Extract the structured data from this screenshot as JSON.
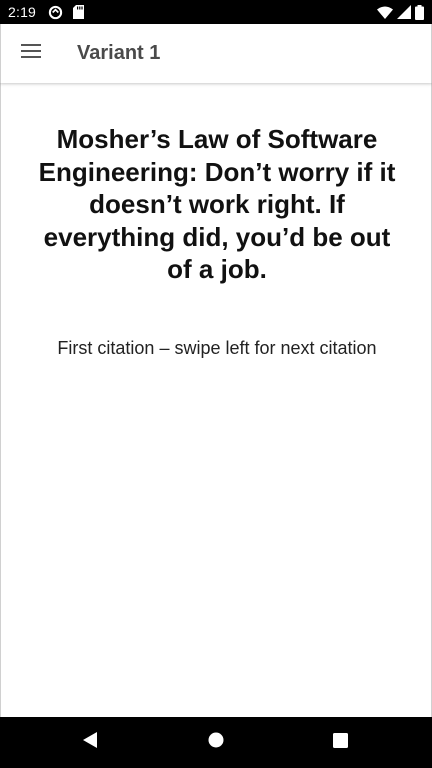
{
  "status_bar": {
    "time": "2:19",
    "icons": [
      "data-saver-icon",
      "sd-card-icon",
      "wifi-icon",
      "signal-icon",
      "battery-icon"
    ]
  },
  "app_bar": {
    "title": "Variant 1",
    "menu_icon": "hamburger-menu-icon"
  },
  "content": {
    "quote": "Mosher’s Law of Software Engineering: Don’t worry if it doesn’t work right. If everything did, you’d be out of a job.",
    "citation_hint": "First citation – swipe left for next citation"
  },
  "nav_bar": {
    "icons": [
      "back-icon",
      "home-icon",
      "recents-icon"
    ]
  },
  "colors": {
    "status_bar_bg": "#000000",
    "app_bar_bg": "#ffffff",
    "title_text": "#4a4a4a",
    "quote_text": "#111111",
    "nav_bar_bg": "#000000"
  }
}
